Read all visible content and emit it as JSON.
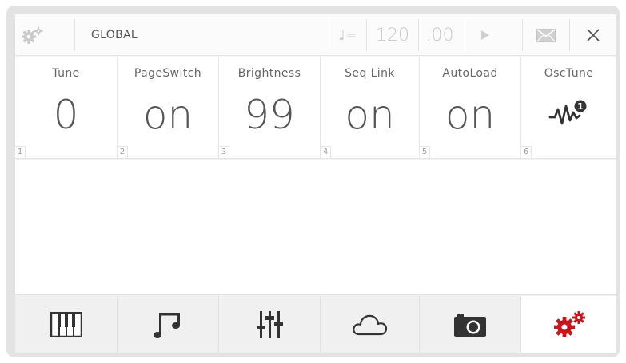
{
  "topbar": {
    "title": "GLOBAL",
    "tempo_symbol": "♩=",
    "tempo_value": "120",
    "tempo_fraction": ".00"
  },
  "params": [
    {
      "label": "Tune",
      "value": "0",
      "index": "1"
    },
    {
      "label": "PageSwitch",
      "value": "on",
      "index": "2"
    },
    {
      "label": "Brightness",
      "value": "99",
      "index": "3"
    },
    {
      "label": "Seq Link",
      "value": "on",
      "index": "4"
    },
    {
      "label": "AutoLoad",
      "value": "on",
      "index": "5"
    },
    {
      "label": "OscTune",
      "value_icon": "wave-badge-icon",
      "badge": "1",
      "index": "6"
    }
  ],
  "bottombar": {
    "items": [
      "piano-keys-icon",
      "music-notes-icon",
      "mixer-sliders-icon",
      "cloud-icon",
      "camera-icon",
      "gears-icon"
    ],
    "active_index": 5
  },
  "colors": {
    "accent_red": "#c8161e",
    "icon_dark": "#333333",
    "muted": "#c7c7c7"
  }
}
